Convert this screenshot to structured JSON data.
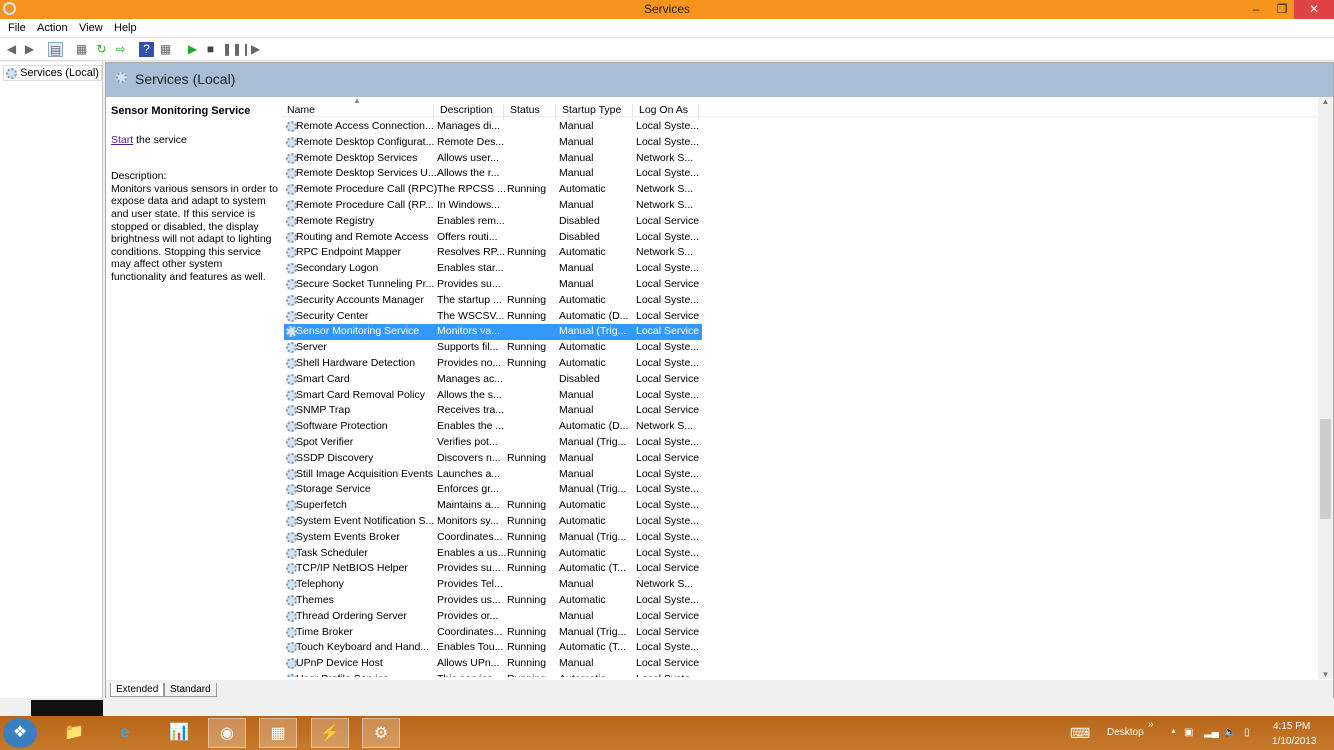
{
  "window": {
    "title": "Services"
  },
  "menu": [
    "File",
    "Action",
    "View",
    "Help"
  ],
  "tree": {
    "root": "Services (Local)"
  },
  "header": {
    "title": "Services (Local)"
  },
  "details": {
    "service_name": "Sensor Monitoring Service",
    "start_link": "Start",
    "start_suffix": " the service",
    "description_label": "Description:",
    "description": "Monitors various sensors in order to expose data and adapt to system and user state.  If this service is stopped or disabled, the display brightness will not adapt to lighting conditions. Stopping this service may affect other system functionality and features as well."
  },
  "columns": [
    "Name",
    "Description",
    "Status",
    "Startup Type",
    "Log On As"
  ],
  "rows": [
    [
      "Remote Access Connection...",
      "Manages di...",
      "",
      "Manual",
      "Local Syste..."
    ],
    [
      "Remote Desktop Configurat...",
      "Remote Des...",
      "",
      "Manual",
      "Local Syste..."
    ],
    [
      "Remote Desktop Services",
      "Allows user...",
      "",
      "Manual",
      "Network S..."
    ],
    [
      "Remote Desktop Services U...",
      "Allows the r...",
      "",
      "Manual",
      "Local Syste..."
    ],
    [
      "Remote Procedure Call (RPC)",
      "The RPCSS ...",
      "Running",
      "Automatic",
      "Network S..."
    ],
    [
      "Remote Procedure Call (RP...",
      "In Windows...",
      "",
      "Manual",
      "Network S..."
    ],
    [
      "Remote Registry",
      "Enables rem...",
      "",
      "Disabled",
      "Local Service"
    ],
    [
      "Routing and Remote Access",
      "Offers routi...",
      "",
      "Disabled",
      "Local Syste..."
    ],
    [
      "RPC Endpoint Mapper",
      "Resolves RP...",
      "Running",
      "Automatic",
      "Network S..."
    ],
    [
      "Secondary Logon",
      "Enables star...",
      "",
      "Manual",
      "Local Syste..."
    ],
    [
      "Secure Socket Tunneling Pr...",
      "Provides su...",
      "",
      "Manual",
      "Local Service"
    ],
    [
      "Security Accounts Manager",
      "The startup ...",
      "Running",
      "Automatic",
      "Local Syste..."
    ],
    [
      "Security Center",
      "The WSCSV...",
      "Running",
      "Automatic (D...",
      "Local Service"
    ],
    [
      "Sensor Monitoring Service",
      "Monitors va...",
      "",
      "Manual (Trig...",
      "Local Service"
    ],
    [
      "Server",
      "Supports fil...",
      "Running",
      "Automatic",
      "Local Syste..."
    ],
    [
      "Shell Hardware Detection",
      "Provides no...",
      "Running",
      "Automatic",
      "Local Syste..."
    ],
    [
      "Smart Card",
      "Manages ac...",
      "",
      "Disabled",
      "Local Service"
    ],
    [
      "Smart Card Removal Policy",
      "Allows the s...",
      "",
      "Manual",
      "Local Syste..."
    ],
    [
      "SNMP Trap",
      "Receives tra...",
      "",
      "Manual",
      "Local Service"
    ],
    [
      "Software Protection",
      "Enables the ...",
      "",
      "Automatic (D...",
      "Network S..."
    ],
    [
      "Spot Verifier",
      "Verifies pot...",
      "",
      "Manual (Trig...",
      "Local Syste..."
    ],
    [
      "SSDP Discovery",
      "Discovers n...",
      "Running",
      "Manual",
      "Local Service"
    ],
    [
      "Still Image Acquisition Events",
      "Launches a...",
      "",
      "Manual",
      "Local Syste..."
    ],
    [
      "Storage Service",
      "Enforces gr...",
      "",
      "Manual (Trig...",
      "Local Syste..."
    ],
    [
      "Superfetch",
      "Maintains a...",
      "Running",
      "Automatic",
      "Local Syste..."
    ],
    [
      "System Event Notification S...",
      "Monitors sy...",
      "Running",
      "Automatic",
      "Local Syste..."
    ],
    [
      "System Events Broker",
      "Coordinates...",
      "Running",
      "Manual (Trig...",
      "Local Syste..."
    ],
    [
      "Task Scheduler",
      "Enables a us...",
      "Running",
      "Automatic",
      "Local Syste..."
    ],
    [
      "TCP/IP NetBIOS Helper",
      "Provides su...",
      "Running",
      "Automatic (T...",
      "Local Service"
    ],
    [
      "Telephony",
      "Provides Tel...",
      "",
      "Manual",
      "Network S..."
    ],
    [
      "Themes",
      "Provides us...",
      "Running",
      "Automatic",
      "Local Syste..."
    ],
    [
      "Thread Ordering Server",
      "Provides or...",
      "",
      "Manual",
      "Local Service"
    ],
    [
      "Time Broker",
      "Coordinates...",
      "Running",
      "Manual (Trig...",
      "Local Service"
    ],
    [
      "Touch Keyboard and Hand...",
      "Enables Tou...",
      "Running",
      "Automatic (T...",
      "Local Syste..."
    ],
    [
      "UPnP Device Host",
      "Allows UPn...",
      "Running",
      "Manual",
      "Local Service"
    ],
    [
      "User Profile Service",
      "This service...",
      "Running",
      "Automatic",
      "Local Syste..."
    ]
  ],
  "selected_index": 13,
  "tabs": [
    "Extended",
    "Standard"
  ],
  "taskbar": {
    "desktop_label": "Desktop",
    "time": "4:15 PM",
    "date": "1/10/2013"
  },
  "colors": {
    "titlebar": "#f7941d",
    "selection": "#3399ff",
    "header": "#a7bed6"
  }
}
